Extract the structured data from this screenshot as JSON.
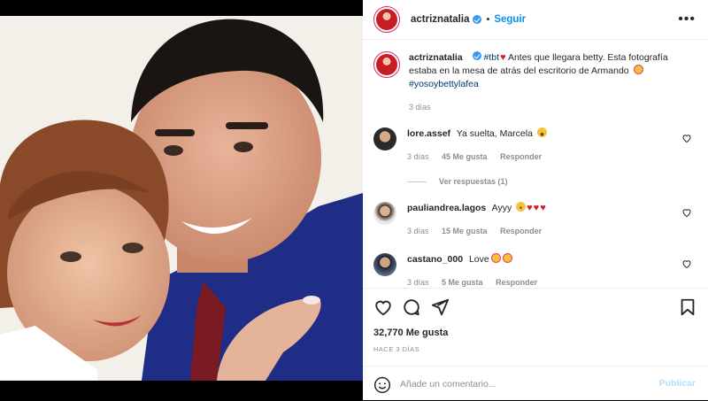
{
  "post": {
    "author": "actriznatalia",
    "follow_label": "Seguir",
    "separator": "•",
    "more_label": "•••"
  },
  "caption": {
    "username": "actriznatalia",
    "hashtag_tbt": "#tbt",
    "text": "Antes que llegara betty. Esta fotografía estaba en la mesa de atrás del escritorio de Armando",
    "hashtag_2": "#yosoybettylafea",
    "time": "3 días"
  },
  "comments": [
    {
      "username": "lore.assef",
      "text": "Ya suelta, Marcela",
      "emoji": "laugh",
      "time": "3 días",
      "likes": "45 Me gusta",
      "reply_label": "Responder"
    },
    {
      "username": "pauliandrea.lagos",
      "text": "Ayyy",
      "emoji": "sad",
      "time": "3 días",
      "likes": "15 Me gusta",
      "reply_label": "Responder"
    },
    {
      "username": "castano_000",
      "text": "Love",
      "emoji": "love",
      "time": "3 días",
      "likes": "5 Me gusta",
      "reply_label": "Responder"
    }
  ],
  "view_replies": "Ver respuestas (1)",
  "likes_total": "32,770 Me gusta",
  "posted_ago": "HACE 3 DÍAS",
  "comment_box": {
    "placeholder": "Añade un comentario...",
    "publish_label": "Publicar"
  },
  "icons": {
    "like": "heart-icon",
    "comment": "comment-icon",
    "share": "send-icon",
    "save": "bookmark-icon",
    "emoji": "emoji-smile-icon"
  },
  "colors": {
    "accent": "#0095f6",
    "publish_disabled": "#b2dffc",
    "muted": "#8e8e8e"
  }
}
